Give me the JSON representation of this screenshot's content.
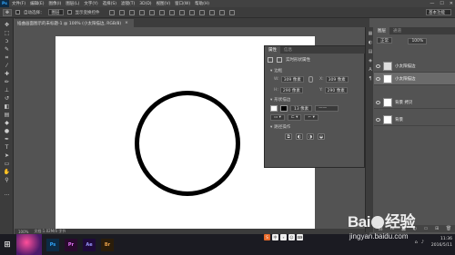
{
  "colors": {
    "ps_blue": "#31a8ff",
    "canvas": "#ffffff",
    "stroke": "#000000",
    "panel": "#535353"
  },
  "menubar": {
    "logo": "Ps",
    "items": [
      "文件(F)",
      "编辑(E)",
      "图像(I)",
      "图层(L)",
      "文字(Y)",
      "选择(S)",
      "滤镜(T)",
      "3D(D)",
      "视图(V)",
      "窗口(W)",
      "帮助(H)"
    ],
    "window_controls": [
      "—",
      "☐",
      "✕"
    ]
  },
  "options": {
    "auto_select_label": "自动选择：",
    "auto_select_value": "图层",
    "transform_label": "显示变换控件",
    "panel_switch": "基本功能"
  },
  "doc_tab": {
    "title": "插曲画面图示的未标题-1 @ 100% (小太阳描边, RGB/8)",
    "close": "×"
  },
  "status": {
    "zoom": "100%",
    "doc": "文档:1.02M/0 字节"
  },
  "properties": {
    "tab_active": "属性",
    "tab_other": "信息",
    "header": "实时形状属性",
    "section_size": "边框",
    "w": "309 像素",
    "x": "309 像素",
    "h": "290 像素",
    "y": "290 像素",
    "section_stroke": "形状描边",
    "stroke_width": "13 像素",
    "section_ops": "路径操作"
  },
  "layers": {
    "tab_active": "图层",
    "tab_other": "通道",
    "kind_label": "正常",
    "opacity": "100%",
    "items": [
      {
        "name": "小太阳描边",
        "selected": false
      },
      {
        "name": "小太阳描边",
        "selected": true
      },
      {
        "name": "背景 拷贝",
        "selected": false
      },
      {
        "name": "背景",
        "selected": false
      }
    ]
  },
  "taskbar": {
    "start": "⊞",
    "apps": [
      "Ps",
      "Pr",
      "Ae",
      "Br"
    ],
    "time": "11:36",
    "date": "2016/5/11",
    "ime": [
      "S",
      "中",
      "∘",
      "☺",
      "⌨"
    ]
  },
  "watermark": {
    "brand": "Bai",
    "brand2": "经验",
    "url": "jingyan.baidu.com"
  }
}
